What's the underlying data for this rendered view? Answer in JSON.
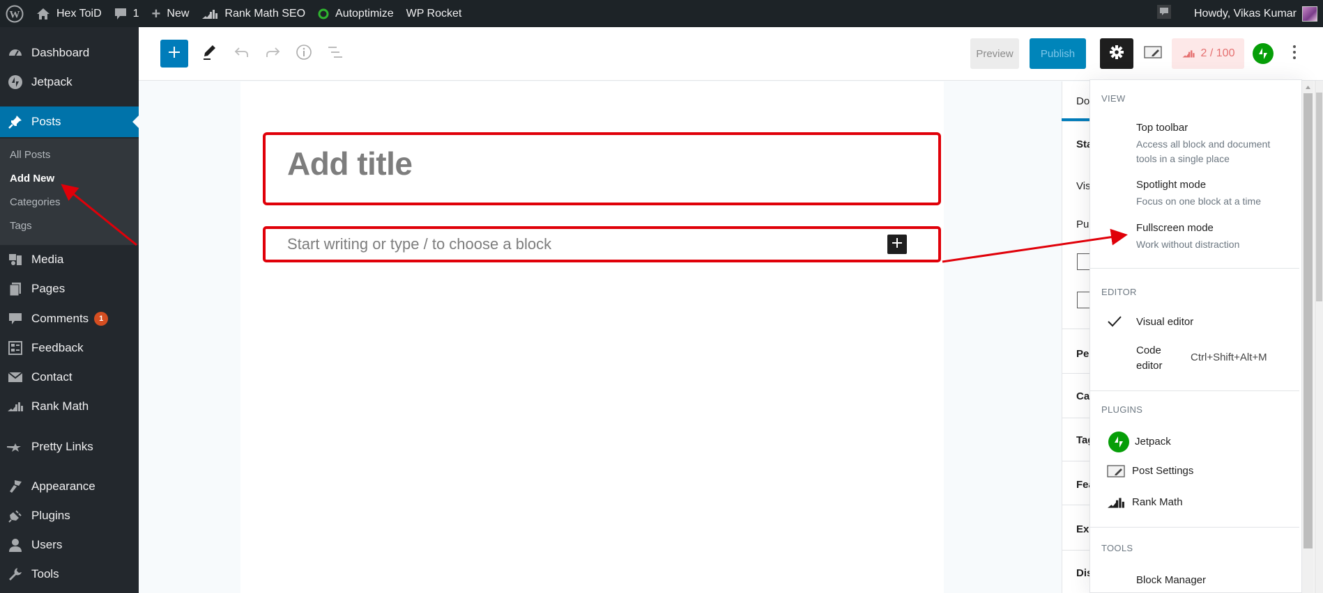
{
  "admin_bar": {
    "site_name": "Hex ToiD",
    "comments_count": "1",
    "new_label": "New",
    "plugins": [
      "Rank Math SEO",
      "Autoptimize",
      "WP Rocket"
    ],
    "greeting": "Howdy, Vikas Kumar"
  },
  "admin_menu": {
    "items": [
      {
        "label": "Dashboard",
        "icon": "dashboard-icon"
      },
      {
        "label": "Jetpack",
        "icon": "jetpack-icon"
      },
      {
        "label": "Posts",
        "icon": "pin-icon",
        "current": true
      },
      {
        "label": "Media",
        "icon": "media-icon"
      },
      {
        "label": "Pages",
        "icon": "pages-icon"
      },
      {
        "label": "Comments",
        "icon": "comment-icon",
        "badge": "1"
      },
      {
        "label": "Feedback",
        "icon": "feedback-icon"
      },
      {
        "label": "Contact",
        "icon": "envelope-icon"
      },
      {
        "label": "Rank Math",
        "icon": "rank-math-icon"
      },
      {
        "label": "Pretty Links",
        "icon": "star-link-icon"
      },
      {
        "label": "Appearance",
        "icon": "brush-icon"
      },
      {
        "label": "Plugins",
        "icon": "plug-icon"
      },
      {
        "label": "Users",
        "icon": "user-icon"
      },
      {
        "label": "Tools",
        "icon": "wrench-icon"
      }
    ],
    "posts_submenu": [
      "All Posts",
      "Add New",
      "Categories",
      "Tags"
    ],
    "current_submenu": "Add New"
  },
  "editor_header": {
    "preview_label": "Preview",
    "publish_label": "Publish",
    "seo_score": "2 / 100"
  },
  "editor": {
    "title_placeholder": "Add title",
    "block_placeholder": "Start writing or type / to choose a block"
  },
  "settings_sidebar": {
    "tab_partial": "Do",
    "labels_partial": [
      "Sta",
      "Vis",
      "Pu",
      "Pe",
      "Ca",
      "Tag",
      "Fea",
      "Exc",
      "Dis"
    ]
  },
  "more_menu": {
    "view": {
      "label": "View",
      "items": [
        {
          "label": "Top toolbar",
          "desc": "Access all block and document tools in a single place"
        },
        {
          "label": "Spotlight mode",
          "desc": "Focus on one block at a time"
        },
        {
          "label": "Fullscreen mode",
          "desc": "Work without distraction"
        }
      ]
    },
    "editor": {
      "label": "Editor",
      "items": [
        {
          "label": "Visual editor",
          "checked": true
        },
        {
          "label": "Code editor",
          "shortcut": "Ctrl+Shift+Alt+M"
        }
      ]
    },
    "plugins": {
      "label": "Plugins",
      "items": [
        "Jetpack",
        "Post Settings",
        "Rank Math"
      ]
    },
    "tools": {
      "label": "Tools",
      "items": [
        "Block Manager"
      ]
    }
  },
  "colors": {
    "annotation_red": "#e00009",
    "wp_blue": "#0073aa",
    "jetpack_green": "#069e08"
  }
}
